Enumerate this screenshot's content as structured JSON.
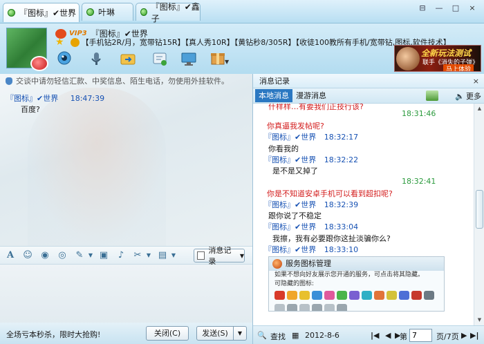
{
  "tabs": [
    {
      "label": "『图标』✔世界",
      "close": "×"
    },
    {
      "label": "叶琳"
    },
    {
      "label": "『图标』✔鑫子"
    }
  ],
  "window_controls": {
    "menu": "⊟",
    "minimize": "—",
    "maximize": "□",
    "close": "×"
  },
  "header": {
    "vip": "VIP3",
    "name": "『图标』✔世界",
    "signature": "【手机钻2R/月，宽带钻15R】【真人秀10R】【黄钻秒8/305R】【收徒100教所有手机/宽带钻,图标,软件技术】"
  },
  "ad": {
    "title": "全新玩法测试",
    "subtitle": "联手《消失的子弹》",
    "button": "马上体验"
  },
  "chat": {
    "notice": "交谈中请勿轻信汇款、中奖信息、陌生电话，勿使用外挂软件。",
    "messages": [
      {
        "name": "『图标』✔世界",
        "time": "18:47:39",
        "text": "百度?"
      }
    ]
  },
  "input_toolbar": {
    "history_button": "消息记录"
  },
  "bottom": {
    "promo": "全场亏本秒杀，限时大抢购!",
    "close_label": "关闭(C)",
    "send_label": "发送(S)"
  },
  "history": {
    "title": "消息记录",
    "close": "×",
    "tab_local": "本地消息",
    "tab_roam": "漫游消息",
    "more": "更多",
    "entries": [
      {
        "kind": "text",
        "class": "hred",
        "text": "什样样…有要我们正技行该?"
      },
      {
        "kind": "time",
        "class": "htime-g",
        "text": "18:31:46"
      },
      {
        "kind": "text",
        "class": "hred",
        "text": "你真逼我发帖呢?"
      },
      {
        "kind": "head",
        "name": "『图标』✔世界",
        "time": "18:32:17"
      },
      {
        "kind": "text",
        "class": "",
        "text": "你看我的"
      },
      {
        "kind": "head",
        "name": "『图标』✔世界",
        "time": "18:32:22"
      },
      {
        "kind": "text",
        "class": "",
        "text": "是不是又掉了"
      },
      {
        "kind": "time",
        "class": "htime-g",
        "text": "18:32:41"
      },
      {
        "kind": "text",
        "class": "hred",
        "text": "你是不知道安卓手机可以看到超扣呢?"
      },
      {
        "kind": "head",
        "name": "『图标』✔世界",
        "time": "18:32:39"
      },
      {
        "kind": "text",
        "class": "",
        "text": "跟你说了不稳定"
      },
      {
        "kind": "head",
        "name": "『图标』✔世界",
        "time": "18:33:04"
      },
      {
        "kind": "text",
        "class": "",
        "text": "我擦，我有必要跟你这扯淡骗你么?"
      },
      {
        "kind": "head",
        "name": "『图标』✔世界",
        "time": "18:33:10"
      }
    ],
    "service_card": {
      "title": "服务图标管理",
      "line1": "如果不想向好友展示您开通的服务，可点击将其隐藏。",
      "line2": "可隐藏的图标:"
    },
    "footer": {
      "search": "查找",
      "date": "2012-8-6",
      "page_label": "第",
      "page_value": "7",
      "page_total": "页/7页"
    }
  }
}
